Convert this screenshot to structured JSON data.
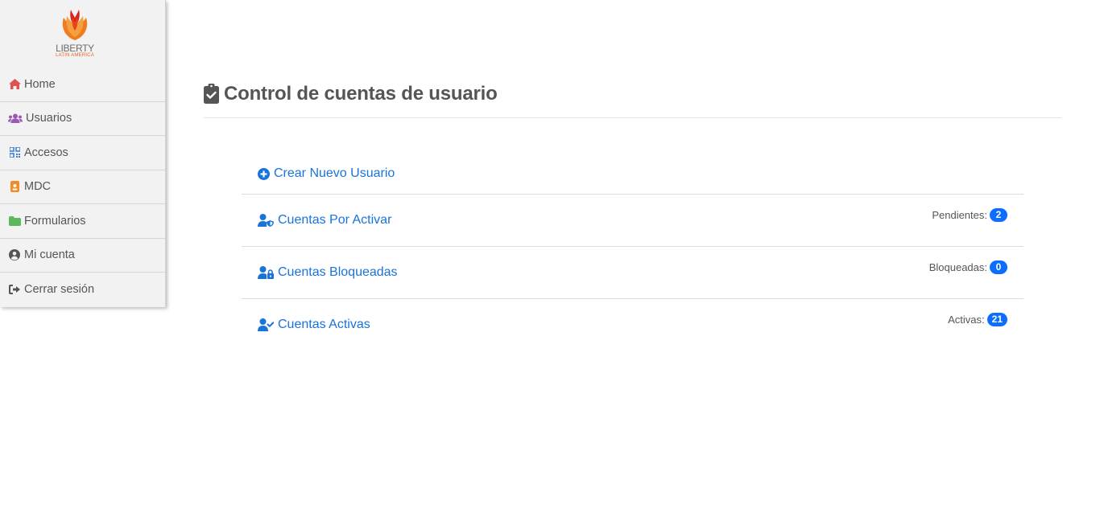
{
  "brand": {
    "name": "LIBERTY",
    "subtitle": "LATIN AMERICA"
  },
  "sidebar": {
    "items": [
      {
        "label": "Home",
        "icon": "home-icon",
        "color": "#e05252"
      },
      {
        "label": "Usuarios",
        "icon": "users-icon",
        "color": "#9b59b6"
      },
      {
        "label": "Accesos",
        "icon": "qrcode-icon",
        "color": "#3a7bd5"
      },
      {
        "label": "MDC",
        "icon": "id-badge-icon",
        "color": "#f28c28"
      },
      {
        "label": "Formularios",
        "icon": "folder-icon",
        "color": "#5cb85c"
      },
      {
        "label": "Mi cuenta",
        "icon": "user-circle-icon",
        "color": "#555555"
      },
      {
        "label": "Cerrar sesión",
        "icon": "sign-out-icon",
        "color": "#555555"
      }
    ]
  },
  "main": {
    "title": "Control de cuentas de usuario",
    "title_icon": "clipboard-check-icon",
    "create_label": "Crear Nuevo Usuario",
    "rows": [
      {
        "label": "Cuentas Por Activar",
        "icon": "user-shield-icon",
        "count_label": "Pendientes:",
        "count": "2"
      },
      {
        "label": "Cuentas Bloqueadas",
        "icon": "user-lock-icon",
        "count_label": "Bloqueadas:",
        "count": "0"
      },
      {
        "label": "Cuentas Activas",
        "icon": "user-check-icon",
        "count_label": "Activas:",
        "count": "21"
      }
    ]
  },
  "colors": {
    "link": "#1a73d9",
    "badge": "#0d6efd",
    "sidebar_bg": "#f2f2f2"
  }
}
